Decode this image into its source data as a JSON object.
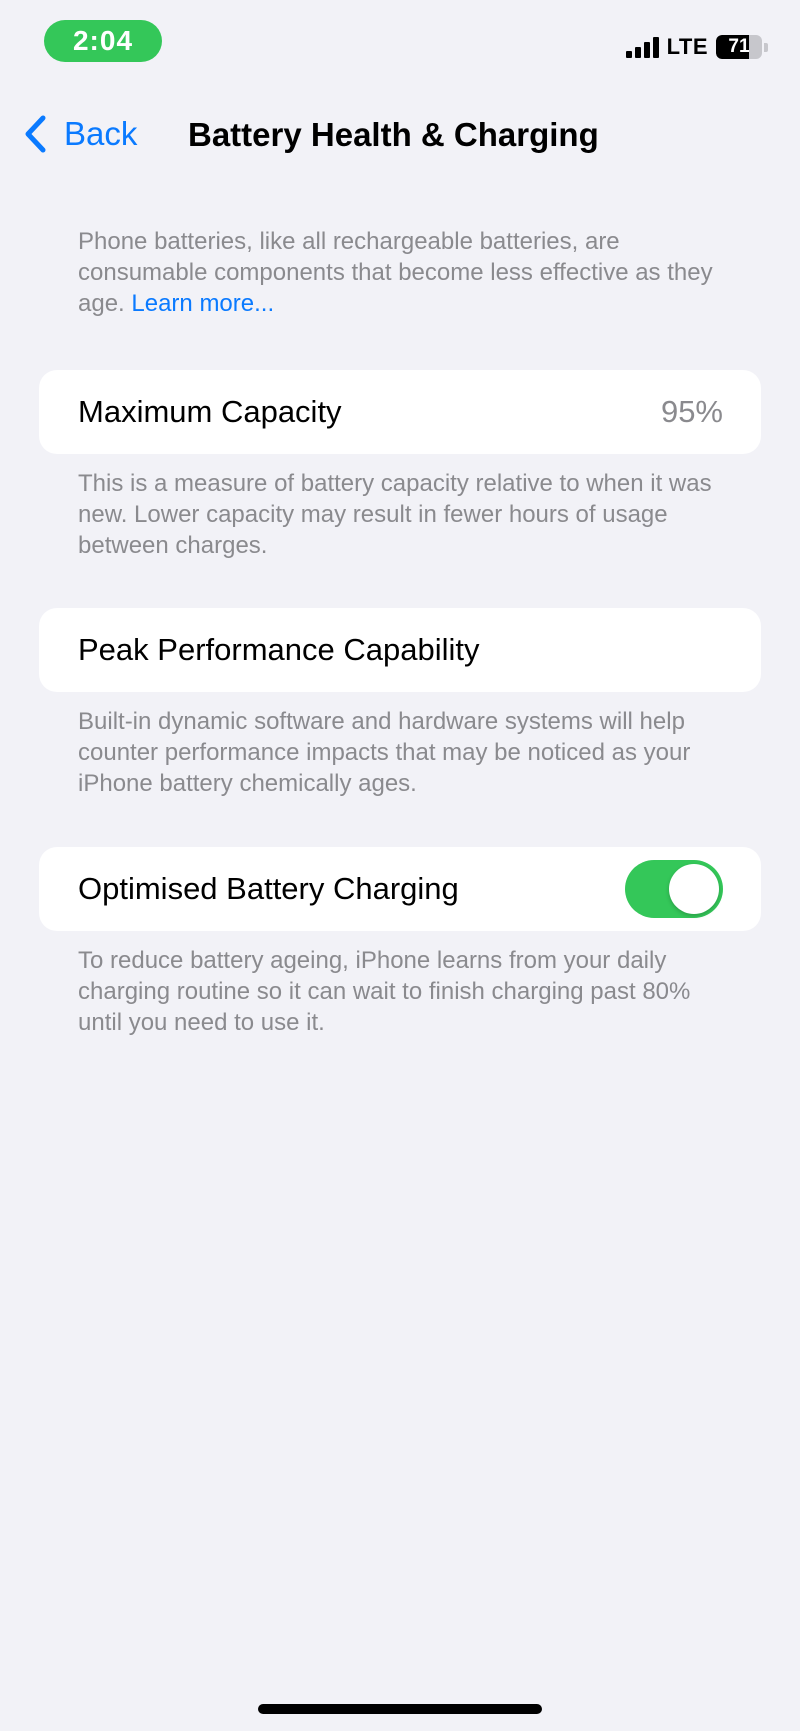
{
  "status_bar": {
    "time": "2:04",
    "network": "LTE",
    "battery_level": "71",
    "battery_fraction": 0.71,
    "icons": [
      "signal-icon",
      "battery-icon"
    ]
  },
  "nav": {
    "back_label": "Back",
    "title": "Battery Health & Charging"
  },
  "intro": {
    "text": "Phone batteries, like all rechargeable batteries, are consumable components that become less effective as they age.",
    "link": "Learn more..."
  },
  "max_capacity": {
    "label": "Maximum Capacity",
    "value": "95%",
    "footnote": "This is a measure of battery capacity relative to when it was new. Lower capacity may result in fewer hours of usage between charges."
  },
  "peak_performance": {
    "label": "Peak Performance Capability",
    "footnote": "Built-in dynamic software and hardware systems will help counter performance impacts that may be noticed as your iPhone battery chemically ages."
  },
  "optimised_charging": {
    "label": "Optimised Battery Charging",
    "enabled": true,
    "footnote": "To reduce battery ageing, iPhone learns from your daily charging routine so it can wait to finish charging past 80% until you need to use it."
  },
  "colors": {
    "accent": "#0a7aff",
    "toggle_on": "#34c759",
    "background": "#f2f2f7",
    "secondary_text": "#8a8a8e"
  }
}
